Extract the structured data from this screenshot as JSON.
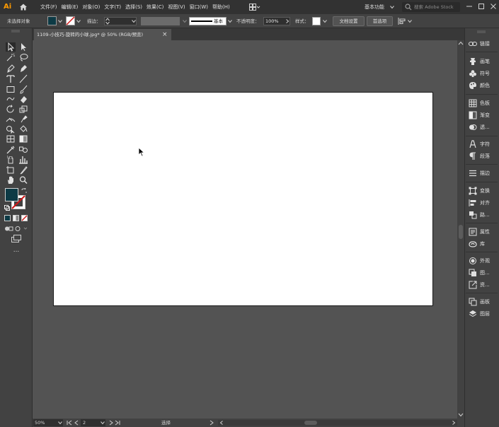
{
  "app": {
    "logo": "Ai"
  },
  "menu": {
    "items": [
      "文件(F)",
      "编辑(E)",
      "对象(O)",
      "文字(T)",
      "选择(S)",
      "效果(C)",
      "视图(V)",
      "窗口(W)",
      "帮助(H)"
    ],
    "workspace": "基本功能",
    "search_placeholder": "搜索 Adobe Stock"
  },
  "control_bar": {
    "selection_status": "未选择对象",
    "stroke_label": "描边：",
    "stroke_profile": "基本",
    "opacity_label": "不透明度：",
    "opacity_value": "100%",
    "style_label": "样式：",
    "document_setup_button": "文档设置",
    "preferences_button": "首选项",
    "fill_color": "#0d3a45"
  },
  "document": {
    "tab_title": "1109-小技巧-旋转的小球.jpg* @ 50% (RGB/预览)",
    "close_glyph": "×"
  },
  "status_bar": {
    "zoom": "50%",
    "artboard_number": "2",
    "current_tool": "选择"
  },
  "toolbar": {
    "fill_color": "#0d3a45",
    "more_tools": "..."
  },
  "panels": [
    {
      "icon": "link-icon",
      "label": "链接"
    },
    {
      "icon": "brush-icon",
      "label": "画笔"
    },
    {
      "icon": "club-icon",
      "label": "符号"
    },
    {
      "icon": "palette-icon",
      "label": "颜色"
    },
    {
      "icon": "grid-icon",
      "label": "色板"
    },
    {
      "icon": "gradient-icon",
      "label": "渐变"
    },
    {
      "icon": "transparency-icon",
      "label": "透..."
    },
    {
      "icon": "character-icon",
      "label": "字符"
    },
    {
      "icon": "paragraph-icon",
      "label": "段落"
    },
    {
      "icon": "stroke-lines-icon",
      "label": "描边"
    },
    {
      "icon": "transform-icon",
      "label": "变换"
    },
    {
      "icon": "align-icon",
      "label": "对齐"
    },
    {
      "icon": "pathfinder-icon",
      "label": "路..."
    },
    {
      "icon": "properties-icon",
      "label": "属性"
    },
    {
      "icon": "libraries-icon",
      "label": "库"
    },
    {
      "icon": "appearance-icon",
      "label": "外观"
    },
    {
      "icon": "graphic-styles-icon",
      "label": "图..."
    },
    {
      "icon": "asset-export-icon",
      "label": "资..."
    },
    {
      "icon": "artboards-icon",
      "label": "画板"
    },
    {
      "icon": "layers-icon",
      "label": "图层"
    }
  ]
}
